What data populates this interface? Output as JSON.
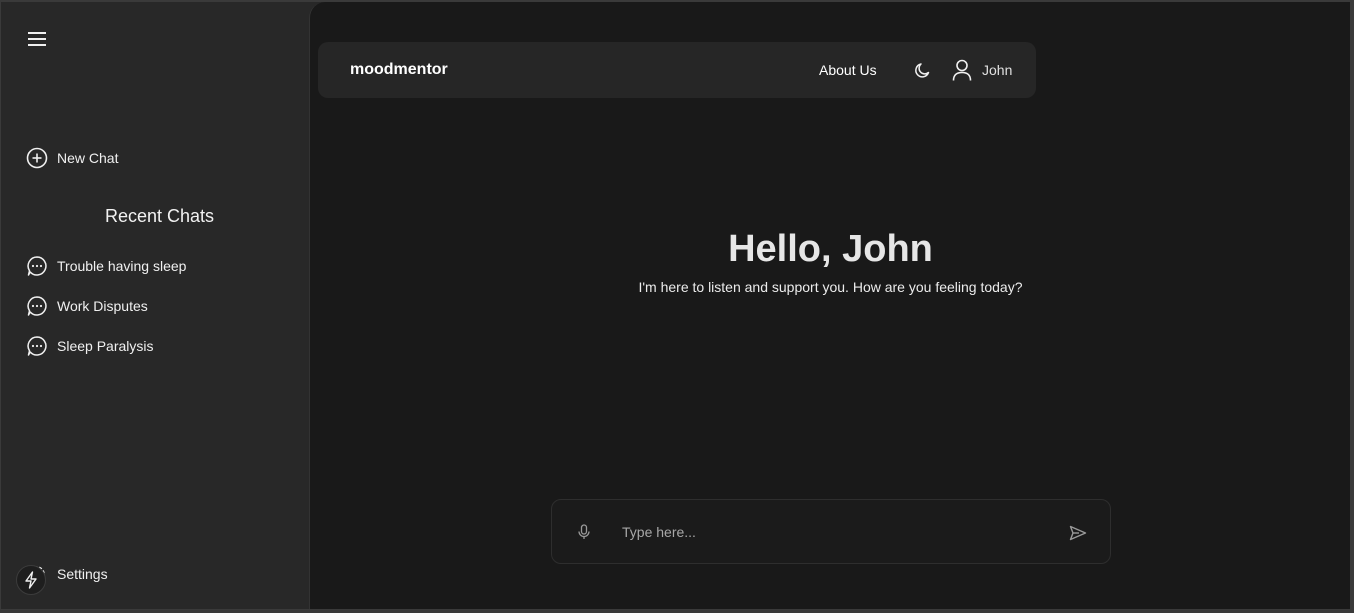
{
  "sidebar": {
    "menu_icon": "hamburger-menu-icon",
    "new_chat_label": "New Chat",
    "recent_title": "Recent Chats",
    "recent_chats": [
      {
        "label": "Trouble having sleep",
        "icon": "chat-bubble-icon"
      },
      {
        "label": "Work Disputes",
        "icon": "chat-bubble-icon"
      },
      {
        "label": "Sleep Paralysis",
        "icon": "chat-bubble-icon"
      }
    ],
    "settings_label": "Settings"
  },
  "header": {
    "brand": "moodmentor",
    "about_label": "About Us",
    "theme_icon": "moon-icon",
    "user_name": "John"
  },
  "main": {
    "greeting": "Hello, John",
    "subtitle": "I'm here to listen and support you. How are you feeling today?",
    "input_placeholder": "Type here...",
    "input_value": ""
  },
  "colors": {
    "sidebar_bg": "#282828",
    "main_bg": "#191919",
    "header_bg": "#262626",
    "text": "#e8e8e8"
  }
}
